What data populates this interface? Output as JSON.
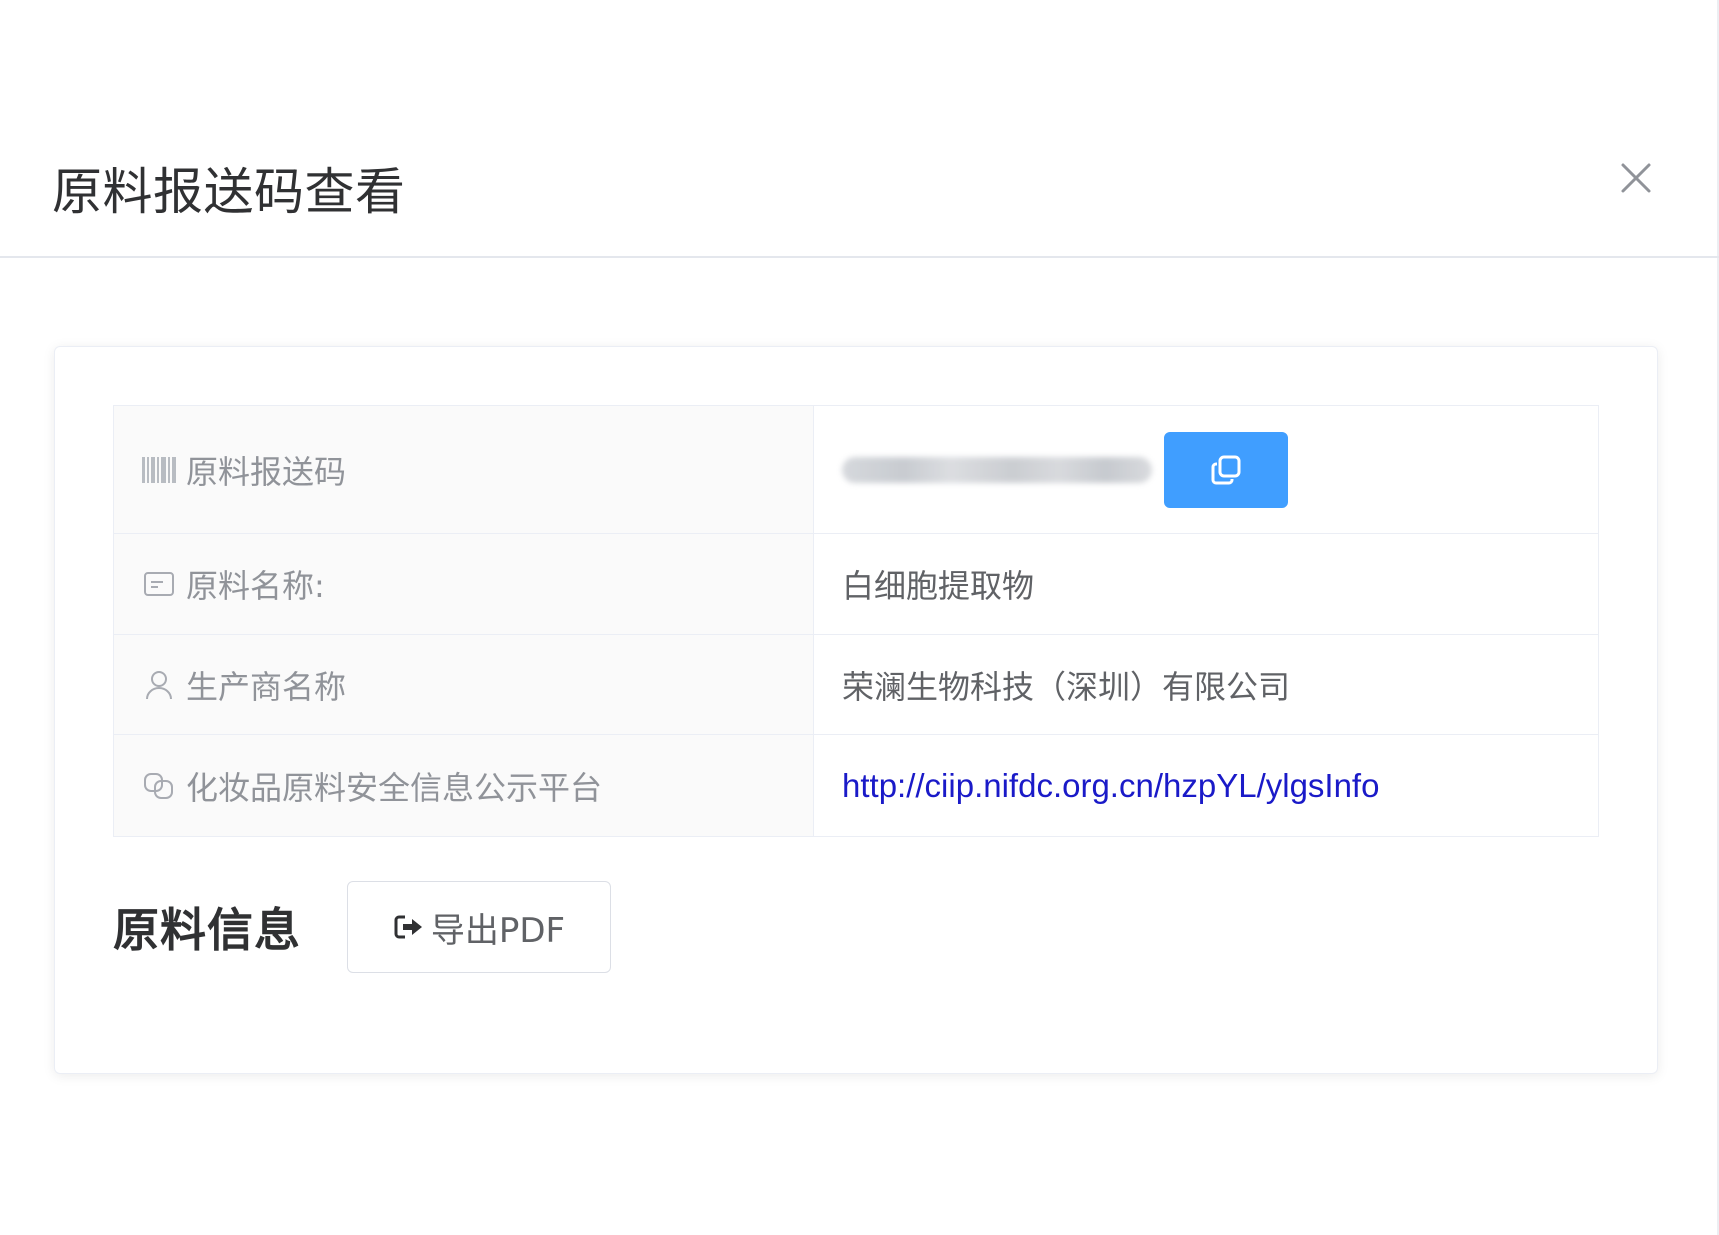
{
  "dialog": {
    "title": "原料报送码查看"
  },
  "rows": [
    {
      "label": "原料报送码",
      "icon": "barcode-icon"
    },
    {
      "label": "原料名称:",
      "value": "白细胞提取物",
      "icon": "card-icon"
    },
    {
      "label": "生产商名称",
      "value": "荣澜生物科技（深圳）有限公司",
      "icon": "user-icon"
    },
    {
      "label": "化妆品原料安全信息公示平台",
      "value": "http://ciip.nifdc.org.cn/hzpYL/ylgsInfo",
      "icon": "link-icon"
    }
  ],
  "section": {
    "title": "原料信息",
    "export_label": "导出PDF"
  },
  "colors": {
    "primary": "#409eff",
    "link": "#1a1ac8",
    "label_bg": "#fafafa",
    "border": "#ebeef5"
  }
}
